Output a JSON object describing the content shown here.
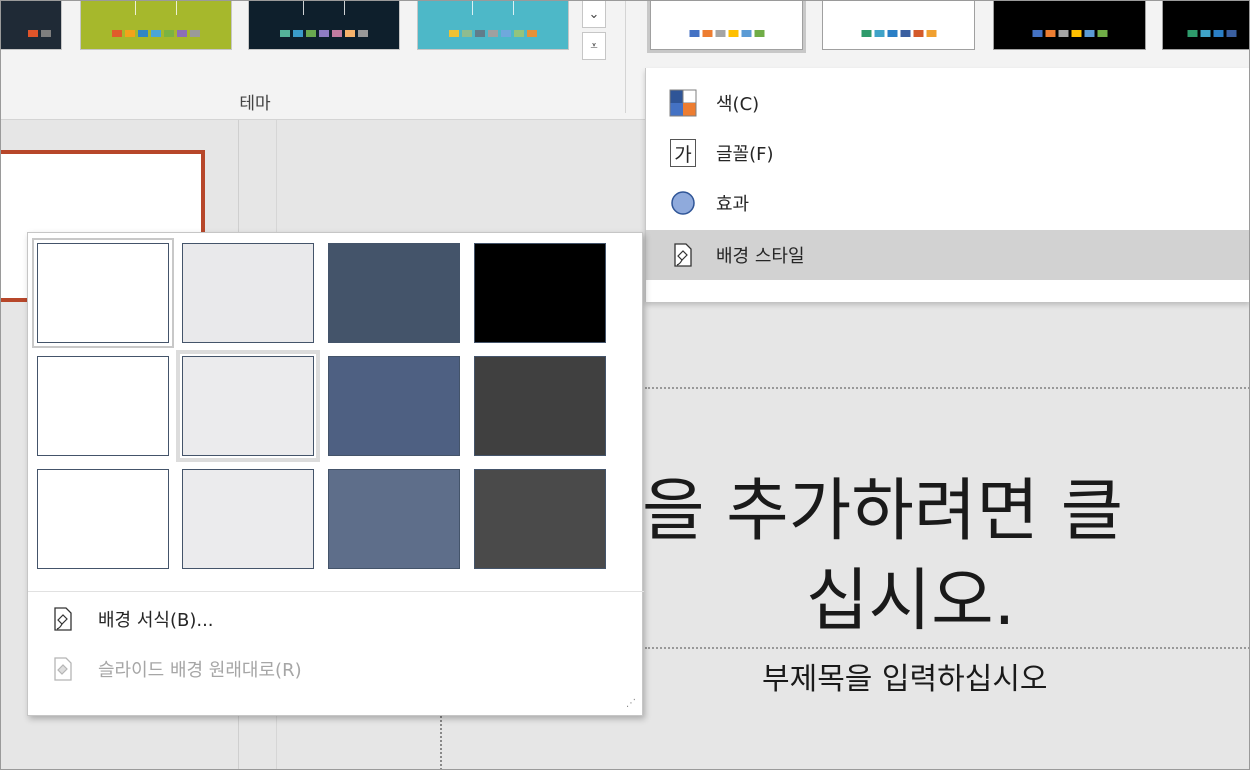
{
  "ribbon": {
    "group_label": "테마",
    "scroll_up": "⌄",
    "more": "⩡",
    "themes": [
      {
        "bg": "#1f2a36",
        "colors": [
          "#e0542a",
          "#7f7f7f"
        ]
      },
      {
        "bg": "#a6b82c",
        "colors": [
          "#e05c2a",
          "#f2a31a",
          "#2f86c6",
          "#4aa5d8",
          "#7bb342",
          "#8c6fb6",
          "#9a9a9a"
        ]
      },
      {
        "bg": "#0e1f2c",
        "colors": [
          "#55b39a",
          "#3a9bc9",
          "#6aa84f",
          "#8e7cc3",
          "#c27ba0",
          "#f6b26b",
          "#999999"
        ]
      },
      {
        "bg": "#4db8c8",
        "colors": [
          "#f1c232",
          "#8fbc8f",
          "#607d8b",
          "#a0a0a0",
          "#6fa8dc",
          "#93c47d",
          "#e69138"
        ]
      }
    ]
  },
  "variants": [
    {
      "bg": "#ffffff",
      "colors": [
        "#4472c4",
        "#ed7d31",
        "#a5a5a5",
        "#ffc000",
        "#5b9bd5",
        "#70ad47"
      ]
    },
    {
      "bg": "#ffffff",
      "colors": [
        "#2e9b6b",
        "#3fa3c8",
        "#2a7fc6",
        "#3a5fa0",
        "#d45a2a",
        "#f0a030"
      ]
    },
    {
      "bg": "#000000",
      "colors": [
        "#4472c4",
        "#ed7d31",
        "#a5a5a5",
        "#ffc000",
        "#5b9bd5",
        "#70ad47"
      ]
    },
    {
      "bg": "#000000",
      "colors": [
        "#2e9b6b",
        "#3fa3c8",
        "#2a7fc6",
        "#3a5fa0"
      ]
    }
  ],
  "menu": {
    "items": [
      {
        "label": "색(C)",
        "icon": "color-swatch-icon"
      },
      {
        "label": "글꼴(F)",
        "icon": "font-ga-icon",
        "glyph": "가"
      },
      {
        "label": "효과",
        "icon": "effects-circle-icon"
      },
      {
        "label": "배경 스타일",
        "icon": "background-style-icon"
      }
    ]
  },
  "gallery": {
    "swatches": [
      [
        "#ffffff",
        "#e9e9eb",
        "#44546a",
        "#000000"
      ],
      [
        "#ffffff",
        "#ebebed",
        "#4e6082",
        "#404040"
      ],
      [
        "#ffffff",
        "#ebebed",
        "#5e6e8a",
        "#4a4a4a"
      ]
    ],
    "format_background": "배경 서식(B)...",
    "reset_background": "슬라이드 배경 원래대로(R)"
  },
  "slide": {
    "title_line1": "을 추가하려면 클",
    "title_line2": "십시오.",
    "subtitle": "부제목을 입력하십시오"
  }
}
